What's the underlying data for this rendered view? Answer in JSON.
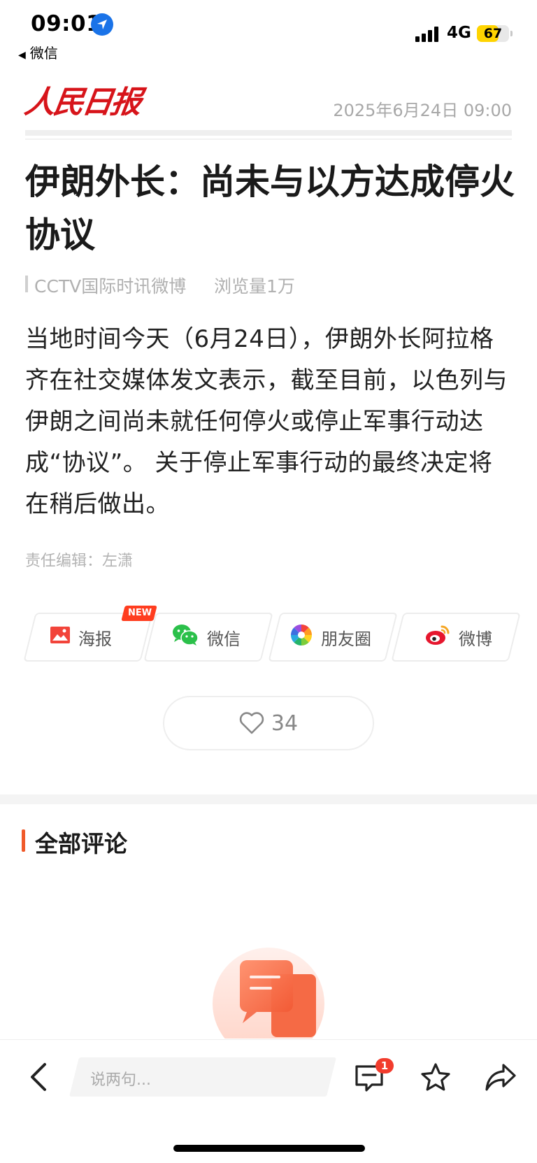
{
  "status_bar": {
    "time": "09:01",
    "back_app": "微信",
    "network": "4G",
    "battery": "67",
    "battery_level": 0.67
  },
  "header": {
    "logo": "人民日报",
    "date": "2025年6月24日 09:00"
  },
  "article": {
    "title": "伊朗外长：尚未与以方达成停火协议",
    "source": "CCTV国际时讯微博",
    "views": "浏览量1万",
    "body": "当地时间今天（6月24日），伊朗外长阿拉格齐在社交媒体发文表示，截至目前，以色列与伊朗之间尚未就任何停火或停止军事行动达成“协议”。 关于停止军事行动的最终决定将在稍后做出。",
    "editor": "责任编辑：左潇"
  },
  "share": {
    "new_badge": "NEW",
    "items": [
      {
        "label": "海报",
        "icon": "poster-icon"
      },
      {
        "label": "微信",
        "icon": "wechat-icon"
      },
      {
        "label": "朋友圈",
        "icon": "moments-icon"
      },
      {
        "label": "微博",
        "icon": "weibo-icon"
      }
    ]
  },
  "likes": {
    "count": "34"
  },
  "comments": {
    "title": "全部评论"
  },
  "bottom_bar": {
    "input_placeholder": "说两句...",
    "comment_count": "1"
  },
  "colors": {
    "brand_red": "#d7141a",
    "accent_orange": "#f05a2a",
    "badge_red": "#f23c2d"
  }
}
